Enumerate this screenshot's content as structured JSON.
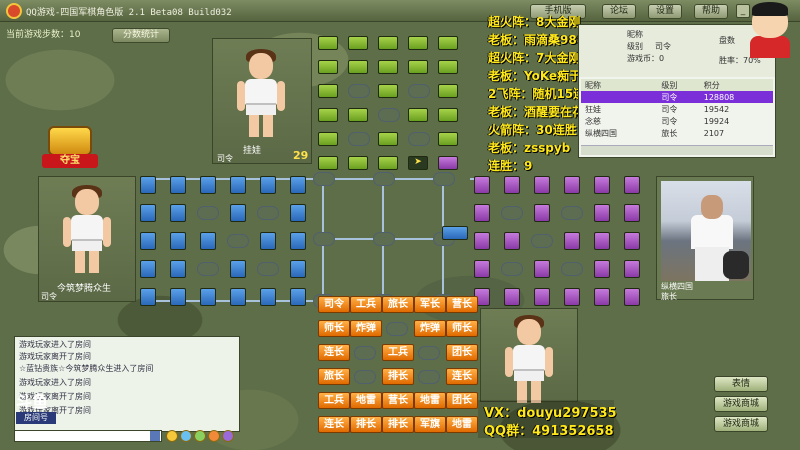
{
  "titlebar": {
    "title": "QQ游戏-四国军棋角色版 2.1 Beta08 Build032",
    "buttons": [
      "手机版",
      "论坛",
      "设置",
      "帮助"
    ]
  },
  "status": {
    "steps_label": "当前游戏步数：10",
    "score_button": "分数统计"
  },
  "treasure_label": "夺宝",
  "players": {
    "top": {
      "name": "挂娃",
      "rank": "司令",
      "count": "29"
    },
    "left": {
      "name": "今筑梦腾众生",
      "rank": "司令"
    },
    "right": {
      "name": "纵横四国",
      "rank": "旅长"
    }
  },
  "overlay": [
    "超火阵：8大金刚",
    "老板：雨滴桑988",
    "超火阵：7大金刚3次",
    "老板：YoKe痴于你",
    "2飞阵：随机15连胜",
    "老板：酒醒要在花下坐1",
    "火箭阵：30连胜",
    "老板：zsspyb",
    "连胜：9"
  ],
  "rank_panel": {
    "nickname_label": "昵称",
    "level_label": "级别",
    "level_value": "司令",
    "games_label": "游戏币：0",
    "deck_label": "盘数",
    "win_label": "胜率：70%",
    "columns": [
      "昵称",
      "级别",
      "积分"
    ],
    "rows": [
      {
        "name": "",
        "level": "司令",
        "score": "128808"
      },
      {
        "name": "狂娃",
        "level": "司令",
        "score": "19542"
      },
      {
        "name": "念慈",
        "level": "司令",
        "score": "19924"
      },
      {
        "name": "纵横四国",
        "level": "旅长",
        "score": "2107"
      }
    ]
  },
  "pieces": [
    [
      "司令",
      "工兵",
      "旅长",
      "军长",
      "营长"
    ],
    [
      "师长",
      "炸弹",
      "",
      "炸弹",
      "师长"
    ],
    [
      "连长",
      "",
      "工兵",
      "",
      "团长"
    ],
    [
      "旅长",
      "",
      "排长",
      "",
      "连长"
    ],
    [
      "工兵",
      "地雷",
      "营长",
      "地雷",
      "团长"
    ],
    [
      "连长",
      "排长",
      "排长",
      "军旗",
      "地雷"
    ]
  ],
  "chat": {
    "lines": [
      "游戏玩家进入了房间",
      "游戏玩家离开了房间",
      "☆蓝钻贵族☆今筑梦腾众生进入了房间",
      "游戏玩家进入了房间",
      "游戏玩家离开了房间",
      "游戏玩家离开了房间"
    ],
    "room_label": "房间号"
  },
  "buttons": {
    "emote": "表情",
    "mini": "游戏商城",
    "exit": "游戏商城"
  },
  "contact": {
    "vx": "VX：douyu297535",
    "qq": "QQ群：491352658"
  },
  "colors": {
    "green_camp": "#6aa020",
    "blue_camp": "#2a68b8",
    "purple_camp": "#8a3aa6",
    "orange_camp": "#e06a00",
    "overlay_text": "#ffe81a"
  }
}
